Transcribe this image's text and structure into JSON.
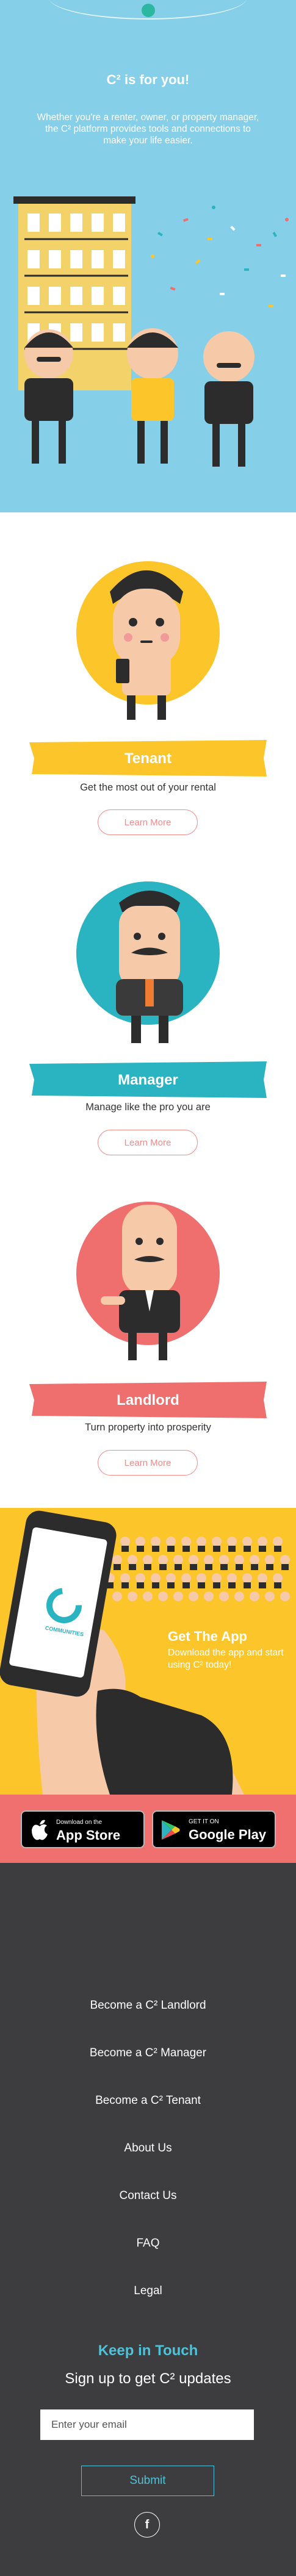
{
  "hero": {
    "title": "C² is for you!",
    "text": "Whether you're a renter, owner, or property manager, the C² platform provides tools and connections to make your life easier."
  },
  "roles": [
    {
      "name": "Tenant",
      "tagline": "Get the most out of your rental",
      "button": "Learn More",
      "circle_color": "#fcc62b",
      "banner_color": "#fcc62b"
    },
    {
      "name": "Manager",
      "tagline": "Manage like the pro you are",
      "button": "Learn More",
      "circle_color": "#2ab4c1",
      "banner_color": "#2ab4c1"
    },
    {
      "name": "Landlord",
      "tagline": "Turn property into prosperity",
      "button": "Learn More",
      "circle_color": "#ef6f6f",
      "banner_color": "#ef6f6f"
    }
  ],
  "app": {
    "title": "Get The App",
    "text": "Download the app and start using C² today!",
    "phone_brand": "COMMUNITIES"
  },
  "stores": {
    "apple": {
      "small": "Download on the",
      "big": "App Store"
    },
    "google": {
      "small": "GET IT ON",
      "big": "Google Play"
    }
  },
  "footer": {
    "links": [
      "Become a C² Landlord",
      "Become a C² Manager",
      "Become a C² Tenant",
      "About Us",
      "Contact Us",
      "FAQ",
      "Legal"
    ],
    "keep_title": "Keep in Touch",
    "signup": "Sign up to get C² updates",
    "email_placeholder": "Enter your email",
    "submit": "Submit",
    "social_icon": "facebook-icon"
  },
  "colors": {
    "hero_bg": "#86cfe9",
    "app_bg": "#fcc62b",
    "store_bar": "#f07070",
    "footer_bg": "#3d3c3e",
    "accent_teal": "#4dc3d9",
    "button_pink": "#f28a8a"
  }
}
